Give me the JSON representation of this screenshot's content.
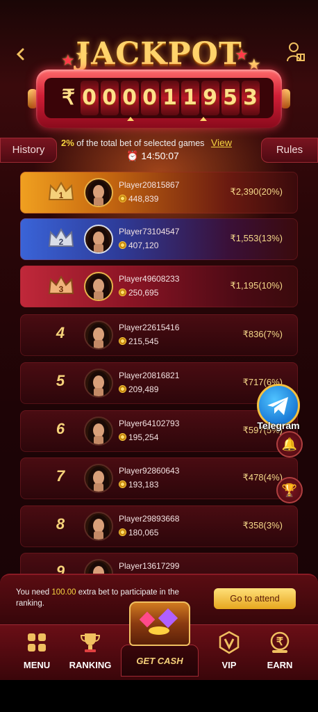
{
  "header": {
    "back_icon": "back-arrow-icon",
    "user_icon": "user-gift-icon",
    "title": "JACKPOT",
    "currency_symbol": "₹",
    "digits": [
      "0",
      "0",
      "0",
      "0",
      "1",
      "1",
      "9",
      "5",
      "3"
    ]
  },
  "side_buttons": {
    "history": "History",
    "rules": "Rules"
  },
  "info": {
    "percent": "2%",
    "text": "of the total bet of selected games",
    "view_link": "View",
    "timer": "14:50:07",
    "clock_icon": "alarm-clock-icon"
  },
  "ranking": [
    {
      "rank": "1",
      "name": "Player20815867",
      "coins": "448,839",
      "prize": "₹2,390(20%)"
    },
    {
      "rank": "2",
      "name": "Player73104547",
      "coins": "407,120",
      "prize": "₹1,553(13%)"
    },
    {
      "rank": "3",
      "name": "Player49608233",
      "coins": "250,695",
      "prize": "₹1,195(10%)"
    },
    {
      "rank": "4",
      "name": "Player22615416",
      "coins": "215,545",
      "prize": "₹836(7%)"
    },
    {
      "rank": "5",
      "name": "Player20816821",
      "coins": "209,489",
      "prize": "₹717(6%)"
    },
    {
      "rank": "6",
      "name": "Player64102793",
      "coins": "195,254",
      "prize": "₹597(5%)"
    },
    {
      "rank": "7",
      "name": "Player92860643",
      "coins": "193,183",
      "prize": "₹478(4%)"
    },
    {
      "rank": "8",
      "name": "Player29893668",
      "coins": "180,065",
      "prize": "₹358(3%)"
    },
    {
      "rank": "9",
      "name": "Player13617299",
      "coins": "",
      "prize": ""
    }
  ],
  "floating": {
    "telegram_label": "Telegram",
    "bell_icon": "bell-icon",
    "trophy_icon": "trophy-icon"
  },
  "notice": {
    "pre": "You need ",
    "amount": "100.00",
    "post": " extra bet to participate in the ranking.",
    "button": "Go to attend"
  },
  "nav": {
    "menu": "MENU",
    "ranking": "RANKING",
    "get_cash": "GET CASH",
    "vip": "VIP",
    "earn": "EARN"
  },
  "colors": {
    "accent_gold": "#f5d440",
    "frame_red": "#d01e36",
    "bg_dark": "#2a0608"
  }
}
